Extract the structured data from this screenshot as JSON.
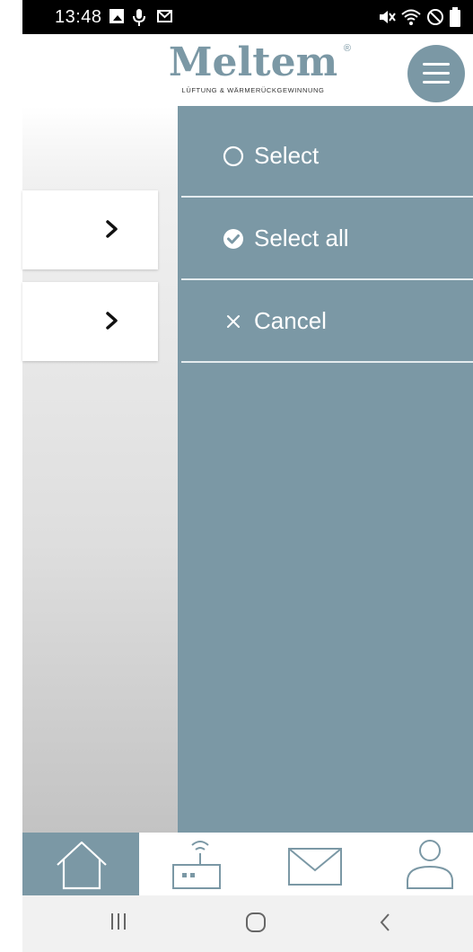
{
  "status_bar": {
    "time": "13:48",
    "icons": [
      "gallery-icon",
      "mic-icon",
      "mail-icon",
      "mute-icon",
      "wifi-icon",
      "blocked-icon",
      "battery-icon"
    ]
  },
  "header": {
    "logo_text": "Meltem",
    "logo_registered": "®",
    "logo_tagline": "LÜFTUNG & WÄRMERÜCKGEWINNUNG",
    "menu_icon": "hamburger-icon"
  },
  "background_list": {
    "rows": [
      {
        "icon": "chevron-right-icon"
      },
      {
        "icon": "chevron-right-icon"
      }
    ]
  },
  "side_menu": {
    "items": [
      {
        "label": "Select",
        "icon": "radio-empty-icon"
      },
      {
        "label": "Select all",
        "icon": "check-circle-icon"
      },
      {
        "label": "Cancel",
        "icon": "close-icon"
      }
    ]
  },
  "tab_bar": {
    "tabs": [
      {
        "name": "home",
        "icon": "home-icon",
        "active": true
      },
      {
        "name": "devices",
        "icon": "router-icon",
        "active": false
      },
      {
        "name": "messages",
        "icon": "mail-icon",
        "active": false
      },
      {
        "name": "profile",
        "icon": "user-icon",
        "active": false
      }
    ]
  },
  "system_nav": {
    "buttons": [
      "recents-icon",
      "home-button-icon",
      "back-icon"
    ]
  },
  "colors": {
    "accent": "#7b98a5",
    "menu_divider": "#e4ebee",
    "status_bar": "#000000",
    "nav_bar": "#f1f1f1"
  }
}
